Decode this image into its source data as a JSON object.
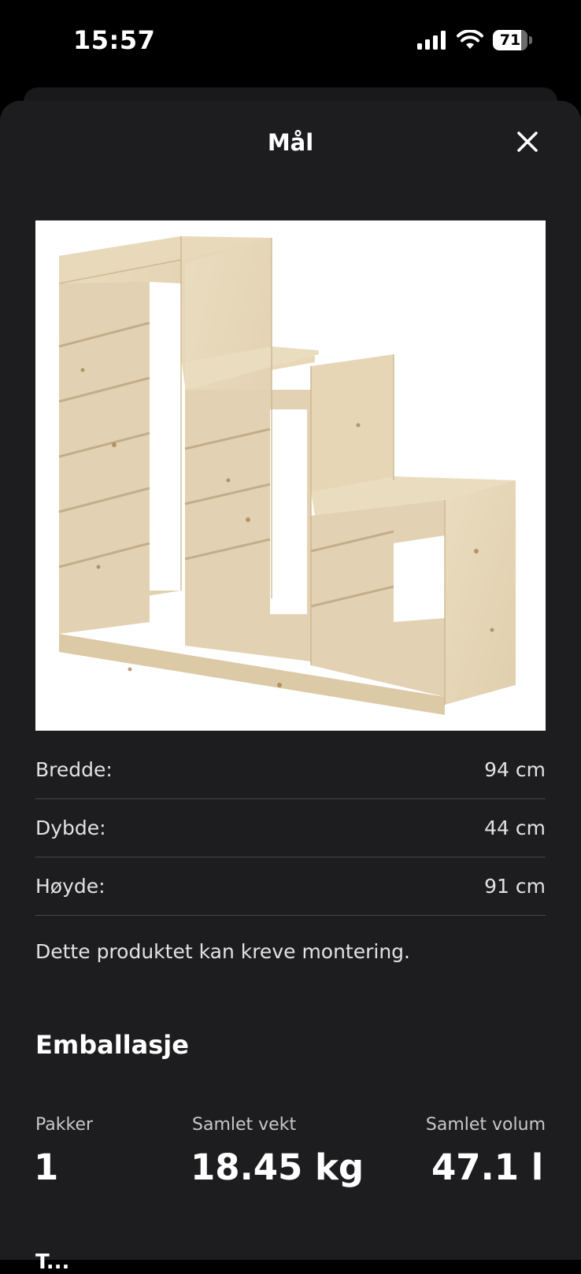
{
  "status_bar": {
    "time": "15:57",
    "battery": "71"
  },
  "sheet": {
    "title": "Mål"
  },
  "dimensions": [
    {
      "label": "Bredde:",
      "value": "94 cm"
    },
    {
      "label": "Dybde:",
      "value": "44 cm"
    },
    {
      "label": "Høyde:",
      "value": "91 cm"
    }
  ],
  "assembly_note": "Dette produktet kan kreve montering.",
  "packaging": {
    "title": "Emballasje",
    "stats": [
      {
        "label": "Pakker",
        "value": "1"
      },
      {
        "label": "Samlet vekt",
        "value": "18.45 kg"
      },
      {
        "label": "Samlet volum",
        "value": "47.1 l"
      }
    ]
  },
  "next_section_partial": "T..."
}
